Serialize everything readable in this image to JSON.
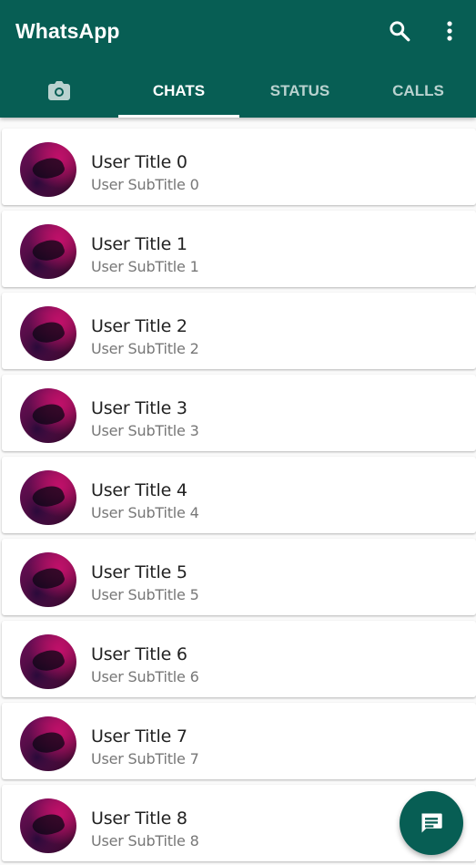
{
  "app": {
    "title": "WhatsApp",
    "brand_color": "#075e54"
  },
  "toolbar": {
    "search_icon": "search-icon",
    "more_icon": "more-vertical-icon"
  },
  "tabs": [
    {
      "label": "",
      "icon": "camera-icon",
      "selected": false
    },
    {
      "label": "CHATS",
      "selected": true
    },
    {
      "label": "STATUS",
      "selected": false
    },
    {
      "label": "CALLS",
      "selected": false
    }
  ],
  "chats": [
    {
      "title": "User Title 0",
      "subtitle": "User SubTitle 0"
    },
    {
      "title": "User Title 1",
      "subtitle": "User SubTitle 1"
    },
    {
      "title": "User Title 2",
      "subtitle": "User SubTitle 2"
    },
    {
      "title": "User Title 3",
      "subtitle": "User SubTitle 3"
    },
    {
      "title": "User Title 4",
      "subtitle": "User SubTitle 4"
    },
    {
      "title": "User Title 5",
      "subtitle": "User SubTitle 5"
    },
    {
      "title": "User Title 6",
      "subtitle": "User SubTitle 6"
    },
    {
      "title": "User Title 7",
      "subtitle": "User SubTitle 7"
    },
    {
      "title": "User Title 8",
      "subtitle": "User SubTitle 8"
    }
  ],
  "fab": {
    "icon": "message-icon"
  }
}
